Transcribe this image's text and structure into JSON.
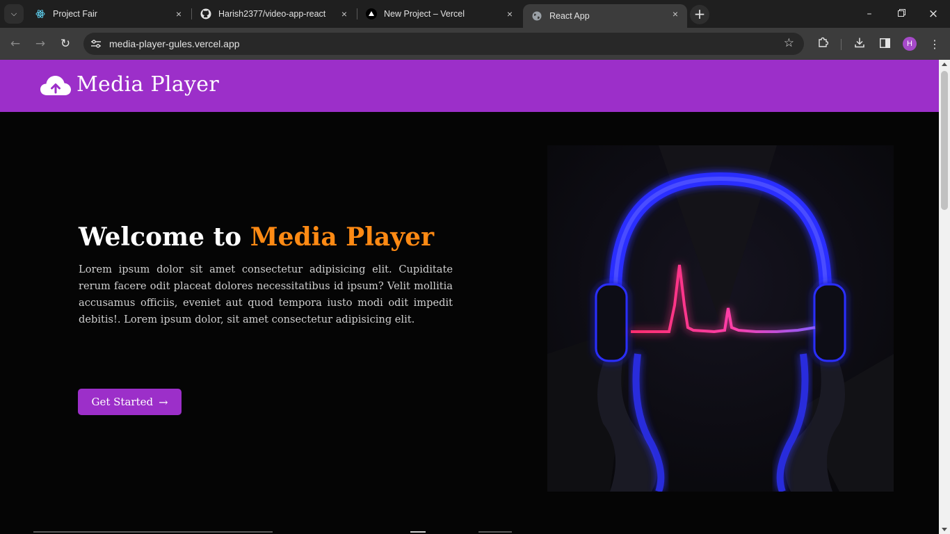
{
  "browser": {
    "tabs": [
      {
        "title": "Project Fair",
        "icon": "react-icon",
        "active": false
      },
      {
        "title": "Harish2377/video-app-react",
        "icon": "github-icon",
        "active": false
      },
      {
        "title": "New Project – Vercel",
        "icon": "vercel-icon",
        "active": false
      },
      {
        "title": "React App",
        "icon": "globe-icon",
        "active": true
      }
    ],
    "url": "media-player-gules.vercel.app",
    "profile_initial": "H"
  },
  "navbar": {
    "brand_title": "Media Player",
    "brand_icon": "cloud-upload-icon",
    "background": "#9c2fc9"
  },
  "hero": {
    "title_prefix": "Welcome to ",
    "title_accent": "Media Player",
    "accent_color": "#ff8a14",
    "body": "Lorem ipsum dolor sit amet consectetur adipisicing elit. Cupiditate rerum facere odit placeat dolores necessitatibus id ipsum? Velit mollitia accusamus officiis, eveniet aut quod tempora iusto modi odit impedit debitis!. Lorem ipsum dolor, sit amet consectetur adipisicing elit.",
    "cta_label": "Get Started",
    "cta_icon": "arrow-right-icon",
    "image": "headphones-heartbeat-illustration"
  }
}
